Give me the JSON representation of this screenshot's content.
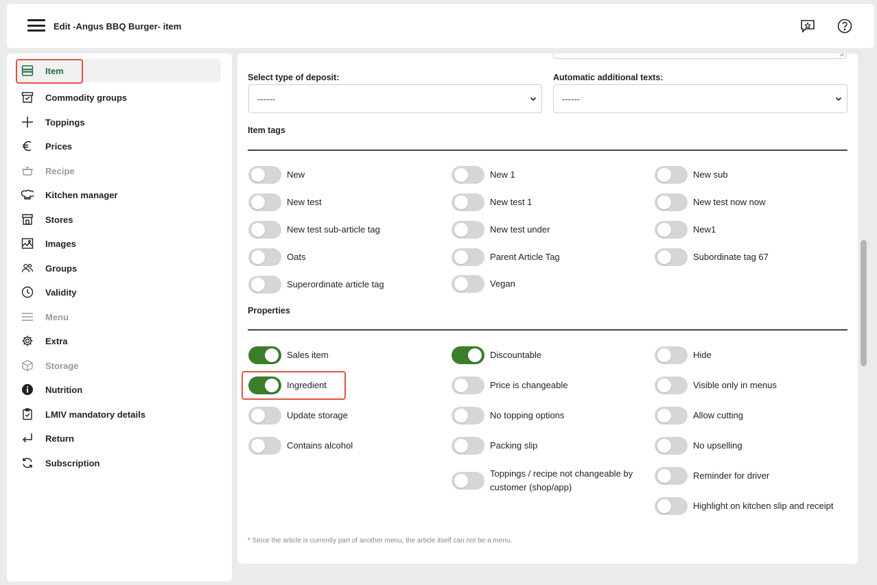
{
  "header": {
    "title": "Edit -Angus BBQ Burger- item",
    "icons": [
      "hamburger-menu-icon",
      "feedback-icon",
      "help-icon"
    ]
  },
  "sidebar": {
    "items": [
      {
        "label": "Item",
        "icon": "stack-icon",
        "active": true,
        "disabled": false
      },
      {
        "label": "Commodity groups",
        "icon": "box-icon",
        "active": false,
        "disabled": false
      },
      {
        "label": "Toppings",
        "icon": "plus-icon",
        "active": false,
        "disabled": false
      },
      {
        "label": "Prices",
        "icon": "euro-icon",
        "active": false,
        "disabled": false
      },
      {
        "label": "Recipe",
        "icon": "pot-icon",
        "active": false,
        "disabled": true
      },
      {
        "label": "Kitchen manager",
        "icon": "chef-hat-icon",
        "active": false,
        "disabled": false
      },
      {
        "label": "Stores",
        "icon": "store-icon",
        "active": false,
        "disabled": false
      },
      {
        "label": "Images",
        "icon": "image-icon",
        "active": false,
        "disabled": false
      },
      {
        "label": "Groups",
        "icon": "users-icon",
        "active": false,
        "disabled": false
      },
      {
        "label": "Validity",
        "icon": "clock-icon",
        "active": false,
        "disabled": false
      },
      {
        "label": "Menu",
        "icon": "lines-icon",
        "active": false,
        "disabled": true
      },
      {
        "label": "Extra",
        "icon": "gear-icon",
        "active": false,
        "disabled": false
      },
      {
        "label": "Storage",
        "icon": "cube-icon",
        "active": false,
        "disabled": true
      },
      {
        "label": "Nutrition",
        "icon": "info-icon",
        "active": false,
        "disabled": false
      },
      {
        "label": "LMIV mandatory details",
        "icon": "clipboard-icon",
        "active": false,
        "disabled": false
      },
      {
        "label": "Return",
        "icon": "return-icon",
        "active": false,
        "disabled": false
      },
      {
        "label": "Subscription",
        "icon": "refresh-icon",
        "active": false,
        "disabled": false
      }
    ]
  },
  "form": {
    "deposit_label": "Select type of deposit:",
    "deposit_value": "------",
    "additional_texts_label": "Automatic additional texts:",
    "additional_texts_value": "------"
  },
  "item_tags": {
    "title": "Item tags",
    "tags": [
      {
        "label": "New",
        "on": false
      },
      {
        "label": "New 1",
        "on": false
      },
      {
        "label": "New sub",
        "on": false
      },
      {
        "label": "New test",
        "on": false
      },
      {
        "label": "New test 1",
        "on": false
      },
      {
        "label": "New test now now",
        "on": false
      },
      {
        "label": "New test sub-article tag",
        "on": false
      },
      {
        "label": "New test under",
        "on": false
      },
      {
        "label": "New1",
        "on": false
      },
      {
        "label": "Oats",
        "on": false
      },
      {
        "label": "Parent Article Tag",
        "on": false
      },
      {
        "label": "Subordinate tag 67",
        "on": false
      },
      {
        "label": "Superordinate article tag",
        "on": false
      },
      {
        "label": "Vegan",
        "on": false
      }
    ]
  },
  "properties": {
    "title": "Properties",
    "items": [
      {
        "label": "Sales item",
        "on": true
      },
      {
        "label": "Discountable",
        "on": true
      },
      {
        "label": "Hide",
        "on": false
      },
      {
        "label": "Ingredient",
        "on": true
      },
      {
        "label": "Price is changeable",
        "on": false
      },
      {
        "label": "Visible only in menus",
        "on": false
      },
      {
        "label": "Update storage",
        "on": false
      },
      {
        "label": "No topping options",
        "on": false
      },
      {
        "label": "Allow cutting",
        "on": false
      },
      {
        "label": "Contains alcohol",
        "on": false
      },
      {
        "label": "Packing slip",
        "on": false
      },
      {
        "label": "No upselling",
        "on": false
      },
      {
        "label": "Toppings / recipe not changeable by customer (shop/app)",
        "on": false
      },
      {
        "label": "Reminder for driver",
        "on": false
      },
      {
        "label": "Highlight on kitchen slip and receipt",
        "on": false
      }
    ]
  },
  "footnote": "* Since the article is currently part of another menu, the article itself can not be a menu.",
  "colors": {
    "accent_green": "#3b7d2a",
    "active_nav_text": "#1f6e43",
    "highlight_red": "#e5533d",
    "toggle_off": "#d6d6d6"
  }
}
